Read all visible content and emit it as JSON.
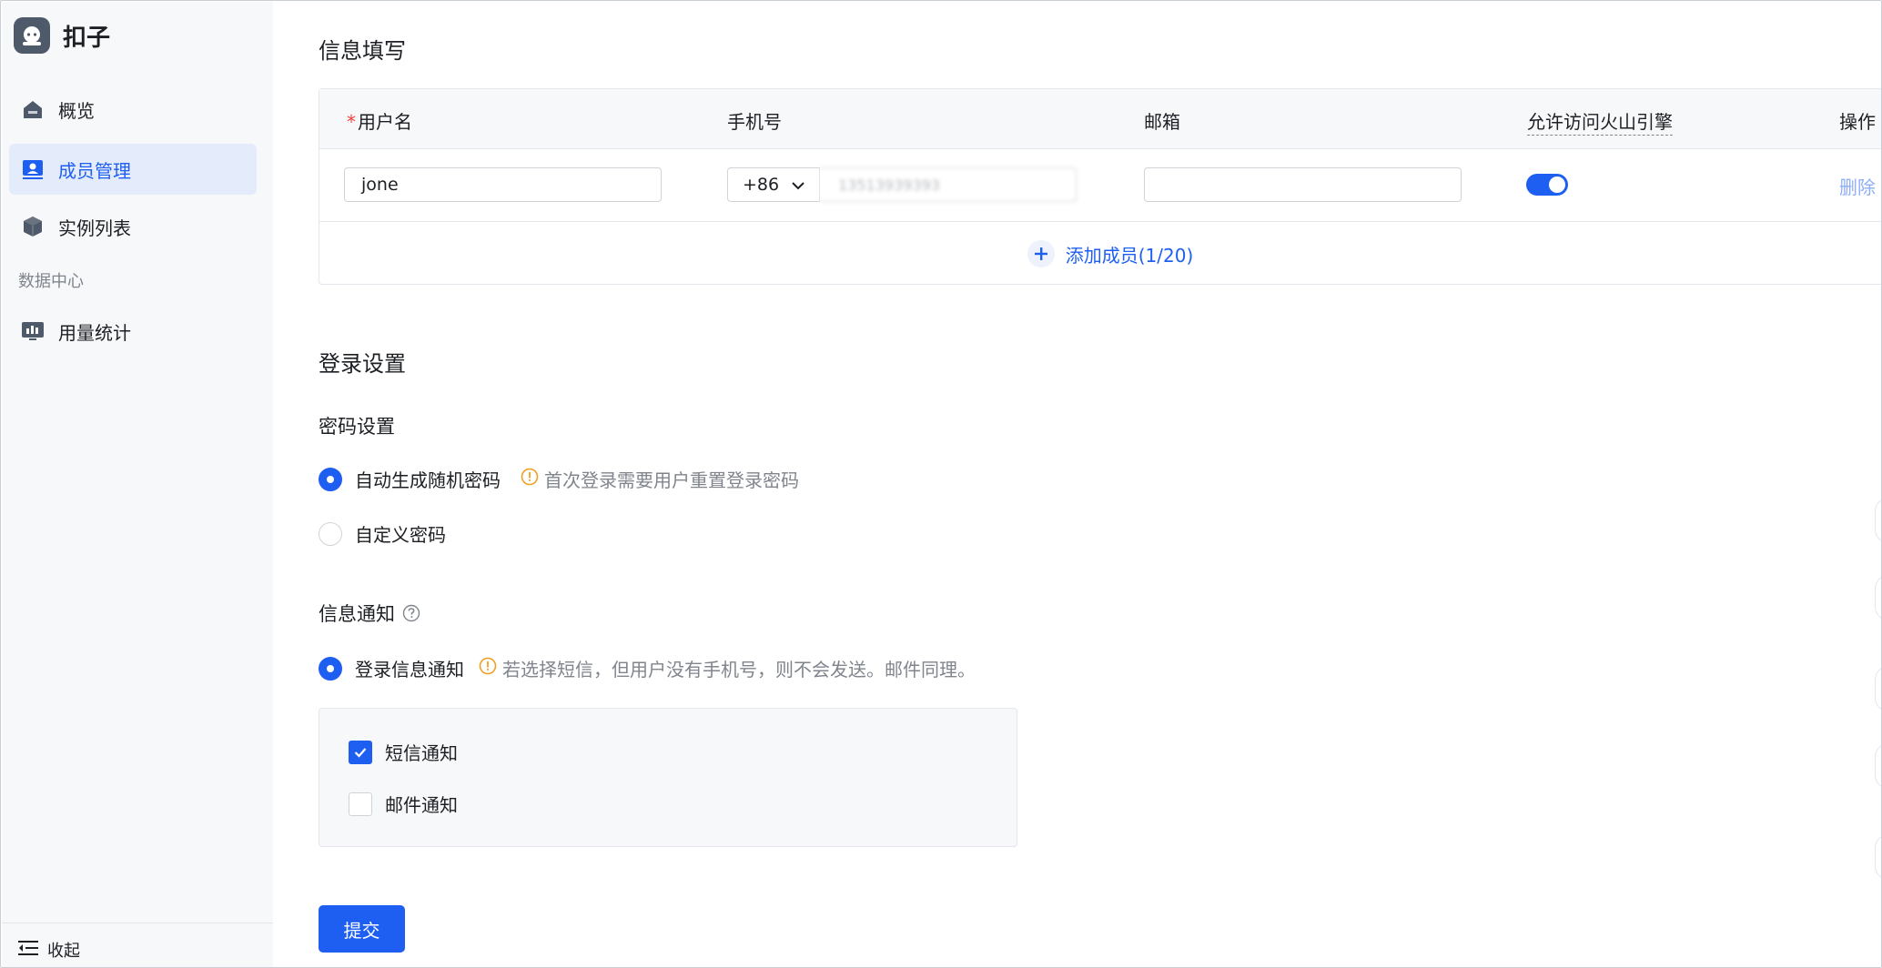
{
  "app": {
    "name": "扣子",
    "logo_icon": "coze-bot-icon"
  },
  "sidebar": {
    "items": [
      {
        "label": "概览",
        "icon": "home-icon",
        "active": false
      },
      {
        "label": "成员管理",
        "icon": "member-card-icon",
        "active": true
      },
      {
        "label": "实例列表",
        "icon": "cube-icon",
        "active": false
      }
    ],
    "section_label": "数据中心",
    "section_items": [
      {
        "label": "用量统计",
        "icon": "chart-monitor-icon",
        "active": false
      }
    ],
    "collapse_label": "收起"
  },
  "info_section": {
    "title": "信息填写",
    "columns": {
      "username": "用户名",
      "phone": "手机号",
      "email": "邮箱",
      "allow": "允许访问火山引擎",
      "action": "操作"
    },
    "row": {
      "username": "jone",
      "phone_code": "+86",
      "phone_number": "13513939393",
      "email": "",
      "allow_enabled": true,
      "delete_label": "删除"
    },
    "add_label": "添加成员(1/20)"
  },
  "login_section": {
    "title": "登录设置",
    "password": {
      "title": "密码设置",
      "options": [
        {
          "label": "自动生成随机密码",
          "selected": true,
          "hint": "首次登录需要用户重置登录密码"
        },
        {
          "label": "自定义密码",
          "selected": false
        }
      ]
    },
    "notify": {
      "title": "信息通知",
      "option": {
        "label": "登录信息通知",
        "selected": true,
        "hint": "若选择短信，但用户没有手机号，则不会发送。邮件同理。"
      },
      "channels": [
        {
          "label": "短信通知",
          "checked": true
        },
        {
          "label": "邮件通知",
          "checked": false
        }
      ]
    }
  },
  "submit_label": "提交",
  "colors": {
    "primary": "#1e5ff2",
    "warning": "#f0a020",
    "required": "#f53f3f",
    "sidebar_bg": "#f7f8fa"
  }
}
